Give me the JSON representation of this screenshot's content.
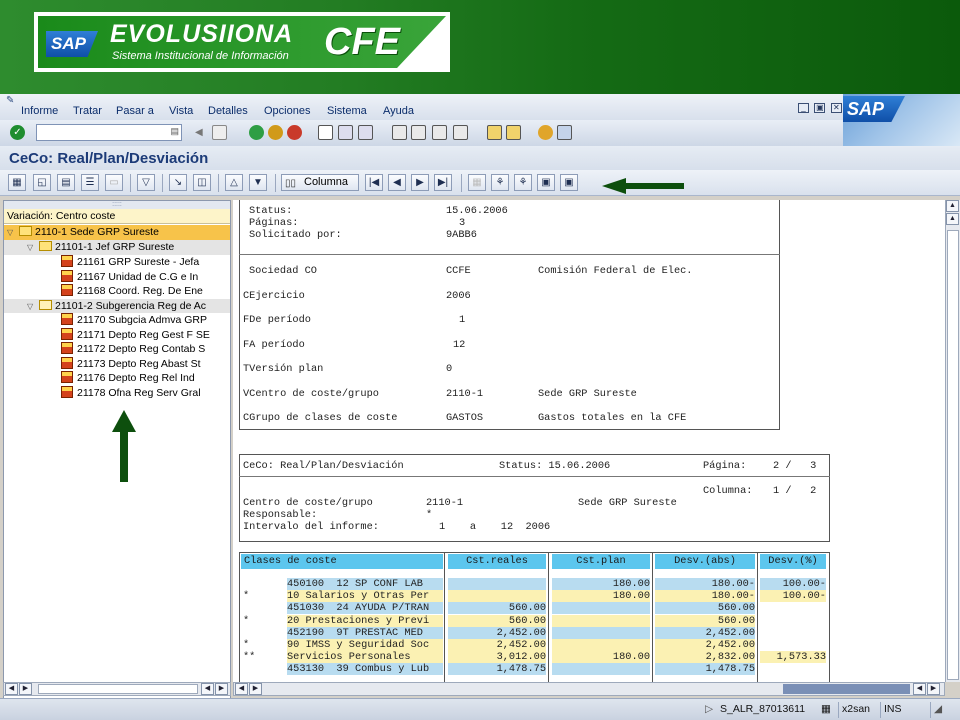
{
  "banner": {
    "sap_logo": "SAP",
    "title": "EVOLUSIIONA",
    "subtitle": "Sistema Institucional de Información",
    "cfe_logo": "CFE"
  },
  "menu": {
    "items": [
      "Informe",
      "Tratar",
      "Pasar a",
      "Vista",
      "Detalles",
      "Opciones",
      "Sistema",
      "Ayuda"
    ],
    "window_controls": [
      "_",
      "▣",
      "✕"
    ],
    "sap_logo": "SAP"
  },
  "command_field": {
    "value": ""
  },
  "app": {
    "title": "CeCo: Real/Plan/Desviación",
    "column_button": "Columna"
  },
  "tree": {
    "grip": ":::::",
    "header": "Variación: Centro coste",
    "nodes": [
      {
        "label": "2110-1 Sede GRP Sureste"
      },
      {
        "label": "21101-1 Jef GRP Sureste"
      },
      {
        "label": "21161 GRP Sureste - Jefa"
      },
      {
        "label": "21167 Unidad de C.G e In"
      },
      {
        "label": "21168 Coord. Reg. De Ene"
      },
      {
        "label": "21101-2 Subgerencia Reg de Ac"
      },
      {
        "label": "21170 Subgcia Admva GRP"
      },
      {
        "label": "21171 Depto Reg Gest F SE"
      },
      {
        "label": "21172 Depto Reg Contab S"
      },
      {
        "label": "21173 Depto Reg Abast St"
      },
      {
        "label": "21176 Depto Reg Rel Ind"
      },
      {
        "label": "21178 Ofna Reg Serv Gral"
      }
    ]
  },
  "report": {
    "status_label": "Status:",
    "status_value": "15.06.2006",
    "pages_label": "Páginas:",
    "pages_value": "3",
    "requested_label": "Solicitado por:",
    "requested_value": "9ABB6",
    "params": [
      {
        "label": "Sociedad CO",
        "value": "CCFE",
        "desc": "Comisión Federal de Elec."
      },
      {
        "label": "CEjercicio",
        "value": "2006",
        "desc": ""
      },
      {
        "label": "FDe período",
        "value": "1",
        "desc": ""
      },
      {
        "label": "FA período",
        "value": "12",
        "desc": ""
      },
      {
        "label": "TVersión plan",
        "value": "0",
        "desc": ""
      },
      {
        "label": "VCentro de coste/grupo",
        "value": "2110-1",
        "desc": "Sede GRP Sureste"
      },
      {
        "label": "CGrupo de clases de coste",
        "value": "GASTOS",
        "desc": "Gastos totales en la CFE"
      }
    ],
    "header2": {
      "title": "CeCo: Real/Plan/Desviación",
      "status": "Status: 15.06.2006",
      "page_label": "Página:",
      "page_value": "2 /   3",
      "column_label": "Columna:",
      "column_value": "1 /   2",
      "cc_label": "Centro de coste/grupo",
      "cc_value": "2110-1",
      "cc_desc": "Sede GRP Sureste",
      "resp_label": "Responsable:",
      "resp_value": "*",
      "interval_label": "Intervalo del informe:",
      "interval_value": "1    a    12  2006"
    },
    "table": {
      "headers": [
        "Clases de coste",
        "Cst.reales",
        "Cst.plan",
        "Desv.(abs)",
        "Desv.(%)"
      ],
      "rows": [
        {
          "mark": "",
          "label": "450100  12 SP CONF LAB",
          "real": "",
          "plan": "180.00",
          "abs": "180.00-",
          "pct": "100.00-",
          "kind": "blue"
        },
        {
          "mark": "*",
          "label": "10 Salarios y Otras Per",
          "real": "",
          "plan": "180.00",
          "abs": "180.00-",
          "pct": "100.00-",
          "kind": "yellow"
        },
        {
          "mark": "",
          "label": "451030  24 AYUDA P/TRAN",
          "real": "560.00",
          "plan": "",
          "abs": "560.00",
          "pct": "",
          "kind": "blue"
        },
        {
          "mark": "*",
          "label": "20 Prestaciones y Previ",
          "real": "560.00",
          "plan": "",
          "abs": "560.00",
          "pct": "",
          "kind": "yellow"
        },
        {
          "mark": "",
          "label": "452190  9T PRESTAC MED",
          "real": "2,452.00",
          "plan": "",
          "abs": "2,452.00",
          "pct": "",
          "kind": "blue"
        },
        {
          "mark": "*",
          "label": "90 IMSS y Seguridad Soc",
          "real": "2,452.00",
          "plan": "",
          "abs": "2,452.00",
          "pct": "",
          "kind": "yellow"
        },
        {
          "mark": "**",
          "label": "Servicios Personales",
          "real": "3,012.00",
          "plan": "180.00",
          "abs": "2,832.00",
          "pct": "1,573.33",
          "kind": "yellow"
        },
        {
          "mark": "",
          "label": "453130  39 Combus y Lub",
          "real": "1,478.75",
          "plan": "",
          "abs": "1,478.75",
          "pct": "",
          "kind": "blue"
        }
      ]
    }
  },
  "status": {
    "transaction": "S_ALR_87013611",
    "server": "x2san",
    "mode": "INS"
  }
}
